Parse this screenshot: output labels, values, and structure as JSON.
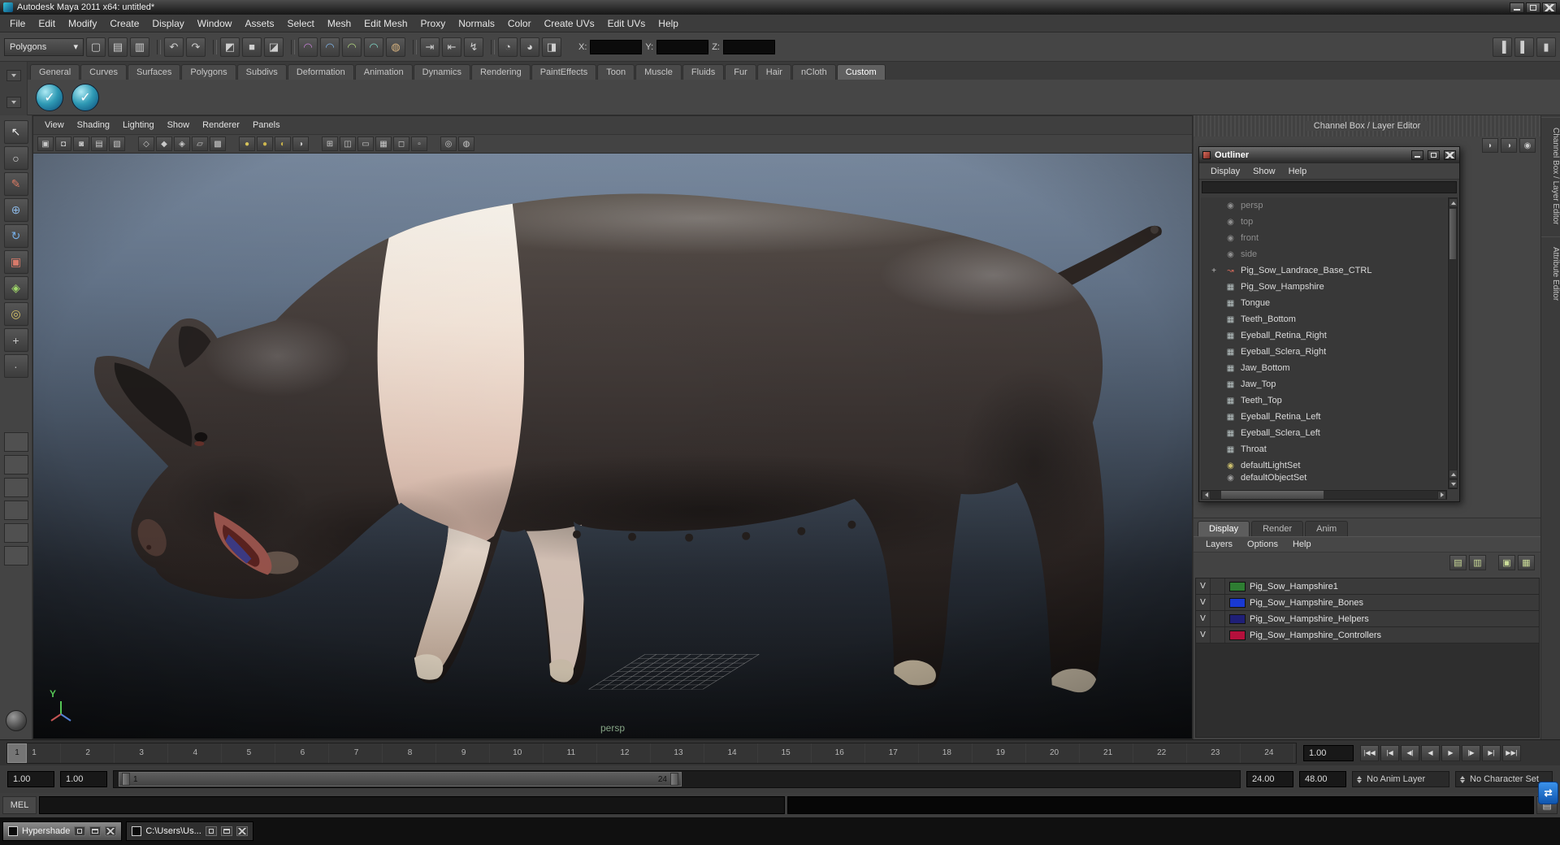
{
  "window": {
    "title": "Autodesk Maya 2011 x64: untitled*"
  },
  "menu_bar": {
    "items": [
      "File",
      "Edit",
      "Modify",
      "Create",
      "Display",
      "Window",
      "Assets",
      "Select",
      "Mesh",
      "Edit Mesh",
      "Proxy",
      "Normals",
      "Color",
      "Create UVs",
      "Edit UVs",
      "Help"
    ]
  },
  "status_line": {
    "mode_dropdown": "Polygons",
    "dropdown_arrow": "▾",
    "icons": [
      {
        "name": "new-scene-icon",
        "glyph": "▢"
      },
      {
        "name": "open-scene-icon",
        "glyph": "▤"
      },
      {
        "name": "save-scene-icon",
        "glyph": "▥"
      },
      {
        "name": "undo-icon",
        "glyph": "↶",
        "sep": true
      },
      {
        "name": "redo-icon",
        "glyph": "↷"
      },
      {
        "name": "select-by-hierarchy-icon",
        "glyph": "◩",
        "sep": true
      },
      {
        "name": "select-by-object-icon",
        "glyph": "■"
      },
      {
        "name": "select-by-component-icon",
        "glyph": "◪"
      },
      {
        "name": "snap-to-grid-icon",
        "glyph": "◠",
        "tint": "#c57fd6",
        "sep": true
      },
      {
        "name": "snap-to-curve-icon",
        "glyph": "◠",
        "tint": "#7fb2e6"
      },
      {
        "name": "snap-to-point-icon",
        "glyph": "◠",
        "tint": "#b2d67f"
      },
      {
        "name": "snap-to-view-plane-icon",
        "glyph": "◠",
        "tint": "#7fd6c5"
      },
      {
        "name": "make-live-icon",
        "glyph": "◍",
        "tint": "#d6b27f"
      },
      {
        "name": "input-connections-icon",
        "glyph": "⇥",
        "sep": true
      },
      {
        "name": "output-connections-icon",
        "glyph": "⇤"
      },
      {
        "name": "construction-history-icon",
        "glyph": "↯"
      },
      {
        "name": "render-current-frame-icon",
        "glyph": "◔",
        "sep": true
      },
      {
        "name": "ipr-render-icon",
        "glyph": "◕"
      },
      {
        "name": "render-settings-icon",
        "glyph": "◨"
      }
    ],
    "coords": {
      "x_label": "X:",
      "y_label": "Y:",
      "z_label": "Z:",
      "x_value": "",
      "y_value": "",
      "z_value": ""
    },
    "right_icons": [
      {
        "name": "show-attribute-editor-icon",
        "glyph": "▐"
      },
      {
        "name": "show-tool-settings-icon",
        "glyph": "▌"
      },
      {
        "name": "show-channel-box-icon",
        "glyph": "▮"
      }
    ]
  },
  "shelf": {
    "tabs": [
      {
        "label": "General"
      },
      {
        "label": "Curves"
      },
      {
        "label": "Surfaces"
      },
      {
        "label": "Polygons"
      },
      {
        "label": "Subdivs"
      },
      {
        "label": "Deformation"
      },
      {
        "label": "Animation"
      },
      {
        "label": "Dynamics"
      },
      {
        "label": "Rendering"
      },
      {
        "label": "PaintEffects"
      },
      {
        "label": "Toon"
      },
      {
        "label": "Muscle"
      },
      {
        "label": "Fluids"
      },
      {
        "label": "Fur"
      },
      {
        "label": "Hair"
      },
      {
        "label": "nCloth"
      },
      {
        "label": "Custom",
        "active": true
      }
    ],
    "buttons": [
      {
        "name": "custom-shelf-item-1",
        "glyph": "✓"
      },
      {
        "name": "custom-shelf-item-2",
        "glyph": "✓"
      }
    ]
  },
  "toolbox": {
    "tools": [
      {
        "name": "select-tool",
        "glyph": "↖",
        "tint": "#ececec"
      },
      {
        "name": "lasso-select-tool",
        "glyph": "○",
        "tint": "#dcdcdc"
      },
      {
        "name": "paint-select-tool",
        "glyph": "✎",
        "tint": "#d87a64"
      },
      {
        "name": "move-tool",
        "glyph": "⊕",
        "tint": "#8ab4e0"
      },
      {
        "name": "rotate-tool",
        "glyph": "↻",
        "tint": "#76aee6"
      },
      {
        "name": "scale-tool",
        "glyph": "▣",
        "tint": "#d87a6a"
      },
      {
        "name": "universal-manipulator-tool",
        "glyph": "◈",
        "tint": "#a0d86a"
      },
      {
        "name": "soft-modification-tool",
        "glyph": "◎",
        "tint": "#d8c46a"
      },
      {
        "name": "show-manipulator-tool",
        "glyph": "+",
        "tint": "#c8c8c8"
      },
      {
        "name": "last-tool-used",
        "glyph": "∙",
        "tint": "#bdbdbd"
      }
    ],
    "layouts": [
      {
        "name": "layout-single-pane",
        "cls": "lay-1"
      },
      {
        "name": "layout-four-pane",
        "cls": "lay-4"
      },
      {
        "name": "layout-three-left",
        "cls": "lay-3l"
      },
      {
        "name": "layout-three-top",
        "cls": "lay-3t"
      },
      {
        "name": "layout-two-side",
        "cls": "lay-2s"
      },
      {
        "name": "layout-outliner-persp",
        "cls": "lay-op"
      }
    ]
  },
  "viewport": {
    "menus": [
      "View",
      "Shading",
      "Lighting",
      "Show",
      "Renderer",
      "Panels"
    ],
    "icons": [
      {
        "name": "select-camera-icon",
        "glyph": "▣"
      },
      {
        "name": "lock-camera-icon",
        "glyph": "◘"
      },
      {
        "name": "camera-attributes-icon",
        "glyph": "◙"
      },
      {
        "name": "bookmarks-icon",
        "glyph": "▤"
      },
      {
        "name": "image-plane-icon",
        "glyph": "▧"
      },
      {
        "name": "wireframe-icon",
        "glyph": "◇",
        "sep": true
      },
      {
        "name": "smooth-shade-icon",
        "glyph": "◆"
      },
      {
        "name": "wire-on-shaded-icon",
        "glyph": "◈"
      },
      {
        "name": "flat-shade-icon",
        "glyph": "▱"
      },
      {
        "name": "textured-icon",
        "glyph": "▩"
      },
      {
        "name": "use-default-lighting-icon",
        "glyph": "●",
        "tint": "#d6c35a",
        "sep": true
      },
      {
        "name": "use-all-lights-icon",
        "glyph": "●",
        "tint": "#cdb64e"
      },
      {
        "name": "shadows-icon",
        "glyph": "◐",
        "tint": "#c8b24a"
      },
      {
        "name": "textured-lights-icon",
        "glyph": "◑"
      },
      {
        "name": "resolution-gate-icon",
        "glyph": "⊞",
        "sep": true
      },
      {
        "name": "film-gate-icon",
        "glyph": "◫"
      },
      {
        "name": "gate-mask-icon",
        "glyph": "▭"
      },
      {
        "name": "field-chart-icon",
        "glyph": "▦"
      },
      {
        "name": "safe-action-icon",
        "glyph": "◻"
      },
      {
        "name": "safe-title-icon",
        "glyph": "▫"
      },
      {
        "name": "isolate-select-icon",
        "glyph": "◎",
        "sep": true
      },
      {
        "name": "xray-icon",
        "glyph": "◍"
      }
    ],
    "camera_label": "persp",
    "axis_label": "Y"
  },
  "right_panel": {
    "header": "Channel Box / Layer Editor",
    "tools": [
      {
        "name": "manip-speed-slow-icon",
        "glyph": "◗"
      },
      {
        "name": "manip-speed-medium-icon",
        "glyph": "◑"
      },
      {
        "name": "manip-hyperbolic-icon",
        "glyph": "◉"
      }
    ],
    "side_tabs": [
      {
        "label": "Channel Box / Layer Editor"
      },
      {
        "label": "Attribute Editor"
      }
    ]
  },
  "outliner": {
    "title": "Outliner",
    "menus": [
      "Display",
      "Show",
      "Help"
    ],
    "items": [
      {
        "label": "persp",
        "icon_name": "camera-icon",
        "glyph": "◉",
        "tint": "#8f8f8f",
        "muted": true,
        "expand": ""
      },
      {
        "label": "top",
        "icon_name": "camera-icon",
        "glyph": "◉",
        "tint": "#8f8f8f",
        "muted": true,
        "expand": ""
      },
      {
        "label": "front",
        "icon_name": "camera-icon",
        "glyph": "◉",
        "tint": "#8f8f8f",
        "muted": true,
        "expand": ""
      },
      {
        "label": "side",
        "icon_name": "camera-icon",
        "glyph": "◉",
        "tint": "#8f8f8f",
        "muted": true,
        "expand": ""
      },
      {
        "label": "Pig_Sow_Landrace_Base_CTRL",
        "icon_name": "nurbs-curve-icon",
        "glyph": "↝",
        "tint": "#d0685a",
        "expand": "+"
      },
      {
        "label": "Pig_Sow_Hampshire",
        "icon_name": "polygon-mesh-icon",
        "glyph": "▦",
        "tint": "#b9c4c4",
        "expand": ""
      },
      {
        "label": "Tongue",
        "icon_name": "polygon-mesh-icon",
        "glyph": "▦",
        "tint": "#b9c4c4",
        "expand": ""
      },
      {
        "label": "Teeth_Bottom",
        "icon_name": "polygon-mesh-icon",
        "glyph": "▦",
        "tint": "#b9c4c4",
        "expand": ""
      },
      {
        "label": "Eyeball_Retina_Right",
        "icon_name": "polygon-mesh-icon",
        "glyph": "▦",
        "tint": "#b9c4c4",
        "expand": ""
      },
      {
        "label": "Eyeball_Sclera_Right",
        "icon_name": "polygon-mesh-icon",
        "glyph": "▦",
        "tint": "#b9c4c4",
        "expand": ""
      },
      {
        "label": "Jaw_Bottom",
        "icon_name": "polygon-mesh-icon",
        "glyph": "▦",
        "tint": "#b9c4c4",
        "expand": ""
      },
      {
        "label": "Jaw_Top",
        "icon_name": "polygon-mesh-icon",
        "glyph": "▦",
        "tint": "#b9c4c4",
        "expand": ""
      },
      {
        "label": "Teeth_Top",
        "icon_name": "polygon-mesh-icon",
        "glyph": "▦",
        "tint": "#b9c4c4",
        "expand": ""
      },
      {
        "label": "Eyeball_Retina_Left",
        "icon_name": "polygon-mesh-icon",
        "glyph": "▦",
        "tint": "#b9c4c4",
        "expand": ""
      },
      {
        "label": "Eyeball_Sclera_Left",
        "icon_name": "polygon-mesh-icon",
        "glyph": "▦",
        "tint": "#b9c4c4",
        "expand": ""
      },
      {
        "label": "Throat",
        "icon_name": "polygon-mesh-icon",
        "glyph": "▦",
        "tint": "#b9c4c4",
        "expand": ""
      },
      {
        "label": "defaultLightSet",
        "icon_name": "object-set-icon",
        "glyph": "◉",
        "tint": "#cdc06e",
        "expand": ""
      },
      {
        "label": "defaultObjectSet",
        "icon_name": "object-set-icon",
        "glyph": "◉",
        "tint": "#9f9f9f",
        "expand": "",
        "partial": true
      }
    ]
  },
  "layer_editor": {
    "tabs": [
      {
        "label": "Display",
        "active": true
      },
      {
        "label": "Render"
      },
      {
        "label": "Anim"
      }
    ],
    "menus": [
      "Layers",
      "Options",
      "Help"
    ],
    "tools": [
      {
        "name": "move-layer-up-icon",
        "glyph": "▤"
      },
      {
        "name": "move-layer-down-icon",
        "glyph": "▥"
      },
      {
        "name": "new-empty-layer-icon",
        "glyph": "▣",
        "sep": true
      },
      {
        "name": "new-layer-from-selected-icon",
        "glyph": "▦"
      }
    ],
    "layers": [
      {
        "vis": "V",
        "name": "Pig_Sow_Hampshire1",
        "color": "#2e7d32"
      },
      {
        "vis": "V",
        "name": "Pig_Sow_Hampshire_Bones",
        "color": "#1939d2"
      },
      {
        "vis": "V",
        "name": "Pig_Sow_Hampshire_Helpers",
        "color": "#1f1f77"
      },
      {
        "vis": "V",
        "name": "Pig_Sow_Hampshire_Controllers",
        "color": "#b5103c"
      }
    ]
  },
  "timeline": {
    "frames": [
      "1",
      "2",
      "3",
      "4",
      "5",
      "6",
      "7",
      "8",
      "9",
      "10",
      "11",
      "12",
      "13",
      "14",
      "15",
      "16",
      "17",
      "18",
      "19",
      "20",
      "21",
      "22",
      "23",
      "24"
    ],
    "current_frame": "1",
    "current_time_field": "1.00",
    "controls": [
      {
        "name": "go-to-start-button",
        "glyph": "|◀◀"
      },
      {
        "name": "step-back-frame-button",
        "glyph": "|◀"
      },
      {
        "name": "step-back-key-button",
        "glyph": "◀|"
      },
      {
        "name": "play-backwards-button",
        "glyph": "◀"
      },
      {
        "name": "play-forwards-button",
        "glyph": "▶"
      },
      {
        "name": "step-forward-key-button",
        "glyph": "|▶"
      },
      {
        "name": "step-forward-frame-button",
        "glyph": "▶|"
      },
      {
        "name": "go-to-end-button",
        "glyph": "▶▶|"
      }
    ]
  },
  "range_slider": {
    "anim_start": "1.00",
    "playback_start": "1.00",
    "range_start_label": "1",
    "range_end_label": "24",
    "playback_end": "24.00",
    "anim_end": "48.00",
    "anim_layer": "No Anim Layer",
    "character_set": "No Character Set"
  },
  "command_line": {
    "label": "MEL",
    "input_value": "",
    "icon_glyph": "▤"
  },
  "taskbar": {
    "windows": [
      {
        "title": "Hypershade",
        "active": true
      },
      {
        "title": "C:\\Users\\Us...",
        "active": false
      }
    ]
  },
  "tray": {
    "glyph": "⇄"
  }
}
